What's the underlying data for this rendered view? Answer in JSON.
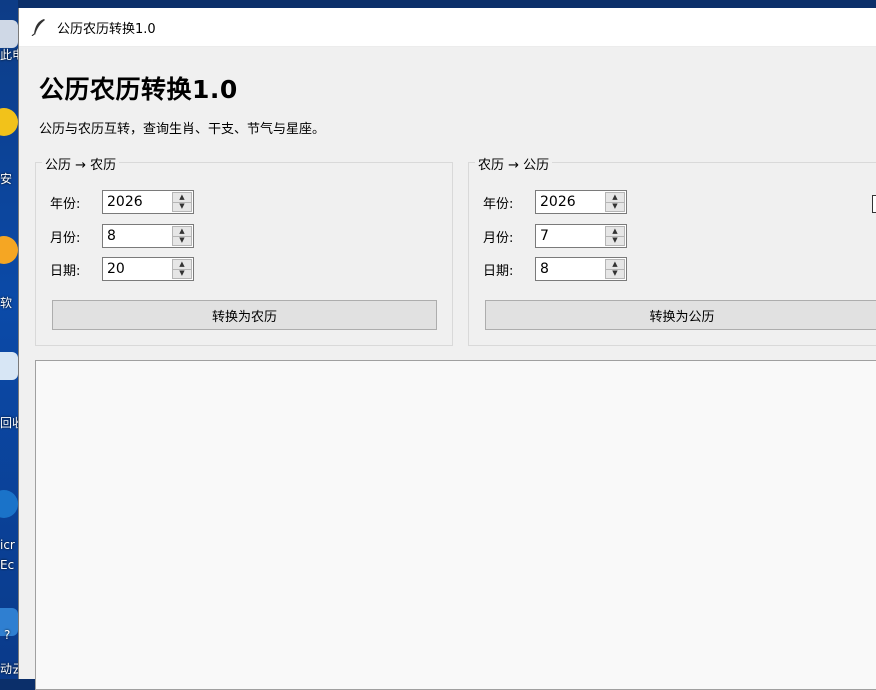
{
  "desktop": {
    "labels": [
      "此电",
      "安",
      "软",
      "回收",
      "icr",
      "Ec",
      "?",
      "动云"
    ]
  },
  "window": {
    "title": "公历农历转换1.0"
  },
  "header": {
    "title": "公历农历转换1.0",
    "subtitle": "公历与农历互转，查询生肖、干支、节气与星座。"
  },
  "solar_to_lunar": {
    "legend": "公历 → 农历",
    "year_label": "年份:",
    "year_value": "2026",
    "month_label": "月份:",
    "month_value": "8",
    "day_label": "日期:",
    "day_value": "20",
    "convert_label": "转换为农历"
  },
  "lunar_to_solar": {
    "legend": "农历 → 公历",
    "year_label": "年份:",
    "year_value": "2026",
    "month_label": "月份:",
    "month_value": "7",
    "day_label": "日期:",
    "day_value": "8",
    "convert_label": "转换为公历"
  },
  "output": {
    "text": ""
  }
}
